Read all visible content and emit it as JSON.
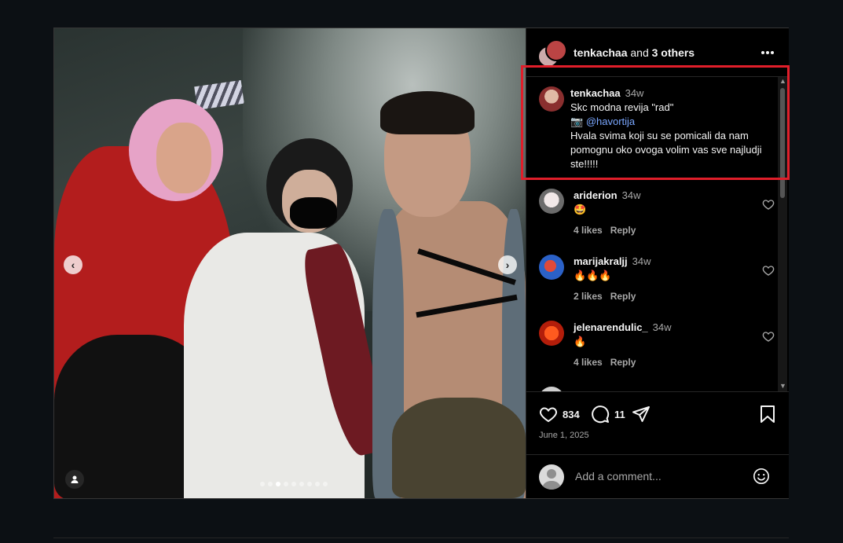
{
  "header": {
    "author": "tenkachaa",
    "connector": " and ",
    "others": "3 others",
    "more_icon": "more-horizontal-icon"
  },
  "caption": {
    "username": "tenkachaa",
    "time": "34w",
    "line1": "Skc modna revija \"rad\"",
    "camera_emoji": "📷",
    "mention": "@havortija",
    "line3": "Hvala svima koji su se pomicali da nam pomognu oko ovoga volim vas sve najludji ste!!!!!"
  },
  "comments": [
    {
      "username": "ariderion",
      "time": "34w",
      "text": "🤩",
      "likes": "4 likes",
      "reply": "Reply"
    },
    {
      "username": "marijakraljj",
      "time": "34w",
      "text": "🔥🔥🔥",
      "likes": "2 likes",
      "reply": "Reply"
    },
    {
      "username": "jelenarendulic_",
      "time": "34w",
      "text": "🔥",
      "likes": "4 likes",
      "reply": "Reply"
    }
  ],
  "actions": {
    "like_count": "834",
    "comment_count": "11",
    "date": "June 1, 2025"
  },
  "compose": {
    "placeholder": "Add a comment..."
  },
  "carousel": {
    "prev": "‹",
    "next": "›",
    "total_slides": 9,
    "active_slide": 3
  },
  "colors": {
    "highlight": "#e01e2a",
    "mention": "#7aa7ff",
    "background": "#0c1014"
  }
}
